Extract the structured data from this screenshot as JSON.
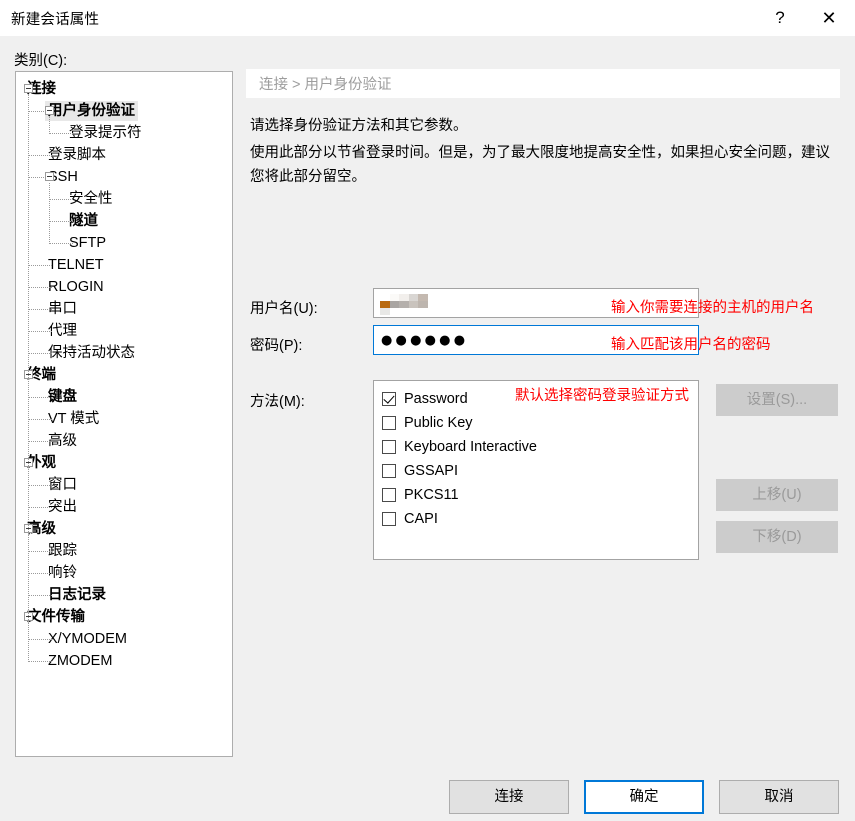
{
  "window": {
    "title": "新建会话属性",
    "help_icon": "?",
    "close_icon": "✕"
  },
  "category": {
    "label": "类别(C):",
    "tree": [
      {
        "label": "连接",
        "depth": 0,
        "expander": true,
        "bold": true,
        "selected": false
      },
      {
        "label": "用户身份验证",
        "depth": 1,
        "expander": true,
        "bold": true,
        "selected": true
      },
      {
        "label": "登录提示符",
        "depth": 2,
        "expander": false,
        "bold": false,
        "selected": false
      },
      {
        "label": "登录脚本",
        "depth": 1,
        "expander": false,
        "bold": false,
        "selected": false
      },
      {
        "label": "SSH",
        "depth": 1,
        "expander": true,
        "bold": false,
        "selected": false
      },
      {
        "label": "安全性",
        "depth": 2,
        "expander": false,
        "bold": false,
        "selected": false
      },
      {
        "label": "隧道",
        "depth": 2,
        "expander": false,
        "bold": true,
        "selected": false
      },
      {
        "label": "SFTP",
        "depth": 2,
        "expander": false,
        "bold": false,
        "selected": false
      },
      {
        "label": "TELNET",
        "depth": 1,
        "expander": false,
        "bold": false,
        "selected": false
      },
      {
        "label": "RLOGIN",
        "depth": 1,
        "expander": false,
        "bold": false,
        "selected": false
      },
      {
        "label": "串口",
        "depth": 1,
        "expander": false,
        "bold": false,
        "selected": false
      },
      {
        "label": "代理",
        "depth": 1,
        "expander": false,
        "bold": false,
        "selected": false
      },
      {
        "label": "保持活动状态",
        "depth": 1,
        "expander": false,
        "bold": false,
        "selected": false
      },
      {
        "label": "终端",
        "depth": 0,
        "expander": true,
        "bold": true,
        "selected": false
      },
      {
        "label": "键盘",
        "depth": 1,
        "expander": false,
        "bold": true,
        "selected": false
      },
      {
        "label": "VT 模式",
        "depth": 1,
        "expander": false,
        "bold": false,
        "selected": false
      },
      {
        "label": "高级",
        "depth": 1,
        "expander": false,
        "bold": false,
        "selected": false
      },
      {
        "label": "外观",
        "depth": 0,
        "expander": true,
        "bold": true,
        "selected": false
      },
      {
        "label": "窗口",
        "depth": 1,
        "expander": false,
        "bold": false,
        "selected": false
      },
      {
        "label": "突出",
        "depth": 1,
        "expander": false,
        "bold": false,
        "selected": false
      },
      {
        "label": "高级",
        "depth": 0,
        "expander": true,
        "bold": true,
        "selected": false
      },
      {
        "label": "跟踪",
        "depth": 1,
        "expander": false,
        "bold": false,
        "selected": false
      },
      {
        "label": "响铃",
        "depth": 1,
        "expander": false,
        "bold": false,
        "selected": false
      },
      {
        "label": "日志记录",
        "depth": 1,
        "expander": false,
        "bold": true,
        "selected": false
      },
      {
        "label": "文件传输",
        "depth": 0,
        "expander": true,
        "bold": true,
        "selected": false
      },
      {
        "label": "X/YMODEM",
        "depth": 1,
        "expander": false,
        "bold": false,
        "selected": false
      },
      {
        "label": "ZMODEM",
        "depth": 1,
        "expander": false,
        "bold": false,
        "selected": false
      }
    ]
  },
  "content": {
    "breadcrumb": "连接 > 用户身份验证",
    "description_line1": "请选择身份验证方法和其它参数。",
    "description_line2": "使用此部分以节省登录时间。但是，为了最大限度地提高安全性，如果担心安全问题，建议您将此部分留空。",
    "username": {
      "label": "用户名(U):",
      "value": "",
      "redacted": true,
      "annotation": "输入你需要连接的主机的用户名"
    },
    "password": {
      "label": "密码(P):",
      "value": "●●●●●●",
      "annotation": "输入匹配该用户名的密码"
    },
    "method": {
      "label": "方法(M):",
      "annotation": "默认选择密码登录验证方式",
      "options": [
        {
          "label": "Password",
          "checked": true
        },
        {
          "label": "Public Key",
          "checked": false
        },
        {
          "label": "Keyboard Interactive",
          "checked": false
        },
        {
          "label": "GSSAPI",
          "checked": false
        },
        {
          "label": "PKCS11",
          "checked": false
        },
        {
          "label": "CAPI",
          "checked": false
        }
      ]
    },
    "side_buttons": {
      "settings": "设置(S)...",
      "move_up": "上移(U)",
      "move_down": "下移(D)"
    }
  },
  "footer": {
    "connect": "连接",
    "ok": "确定",
    "cancel": "取消"
  },
  "colors": {
    "dialog_background": "#f0f0f0",
    "titlebar_background": "#ffffff",
    "accent_focus": "#0078d7",
    "annotation_red": "#ff0000",
    "breadcrumb_text": "#9d9d9d",
    "disabled_button": "#cccccc"
  }
}
